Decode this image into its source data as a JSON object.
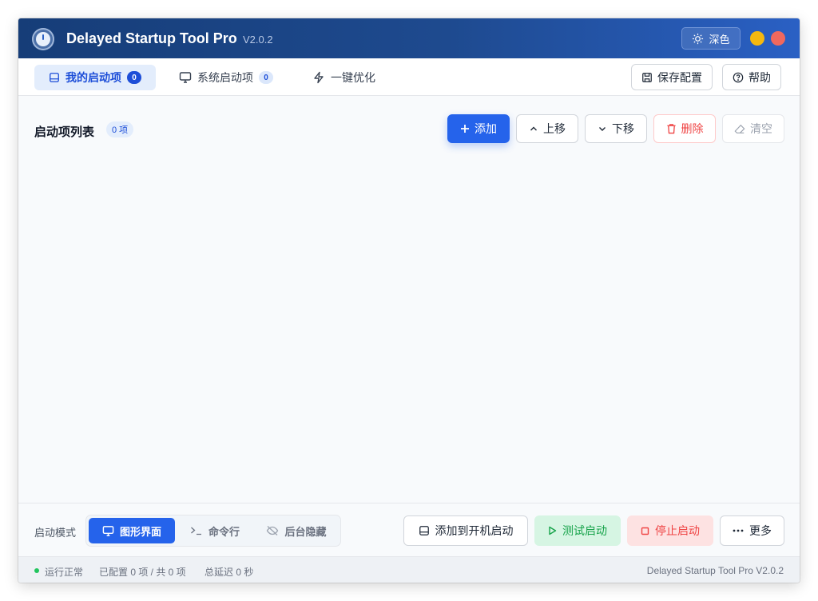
{
  "titlebar": {
    "app_name": "Delayed Startup Tool Pro",
    "version": "V2.0.2",
    "theme_label": "深色",
    "colors": {
      "minimize": "#f5b80f",
      "close": "#f0685e"
    }
  },
  "nav": {
    "tabs": [
      {
        "label": "我的启动项",
        "count": "0",
        "icon": "window-icon",
        "active": true
      },
      {
        "label": "系统启动项",
        "count": "0",
        "icon": "monitor-icon",
        "active": false
      },
      {
        "label": "一键优化",
        "icon": "lightning-icon",
        "active": false
      }
    ],
    "save_config": "保存配置",
    "help": "帮助"
  },
  "list": {
    "title": "启动项列表",
    "count_badge": "0 项",
    "actions": {
      "add": "添加",
      "move_up": "上移",
      "move_down": "下移",
      "delete": "删除",
      "clear": "清空"
    }
  },
  "bottom": {
    "mode_label": "启动模式",
    "modes": [
      {
        "label": "图形界面",
        "icon": "monitor-icon",
        "active": true
      },
      {
        "label": "命令行",
        "icon": "terminal-icon",
        "active": false
      },
      {
        "label": "后台隐藏",
        "icon": "eye-off-icon",
        "active": false
      }
    ],
    "add_to_boot": "添加到开机启动",
    "test_start": "测试启动",
    "stop_start": "停止启动",
    "more": "更多"
  },
  "status": {
    "running": "运行正常",
    "configured": "已配置 0 项 / 共 0 项",
    "total_delay": "总延迟 0 秒",
    "footer": "Delayed Startup Tool Pro V2.0.2"
  },
  "colors": {
    "accent": "#2563eb",
    "titlebar": "#1e4a8f",
    "success": "#22c55e",
    "danger": "#ef4444"
  }
}
